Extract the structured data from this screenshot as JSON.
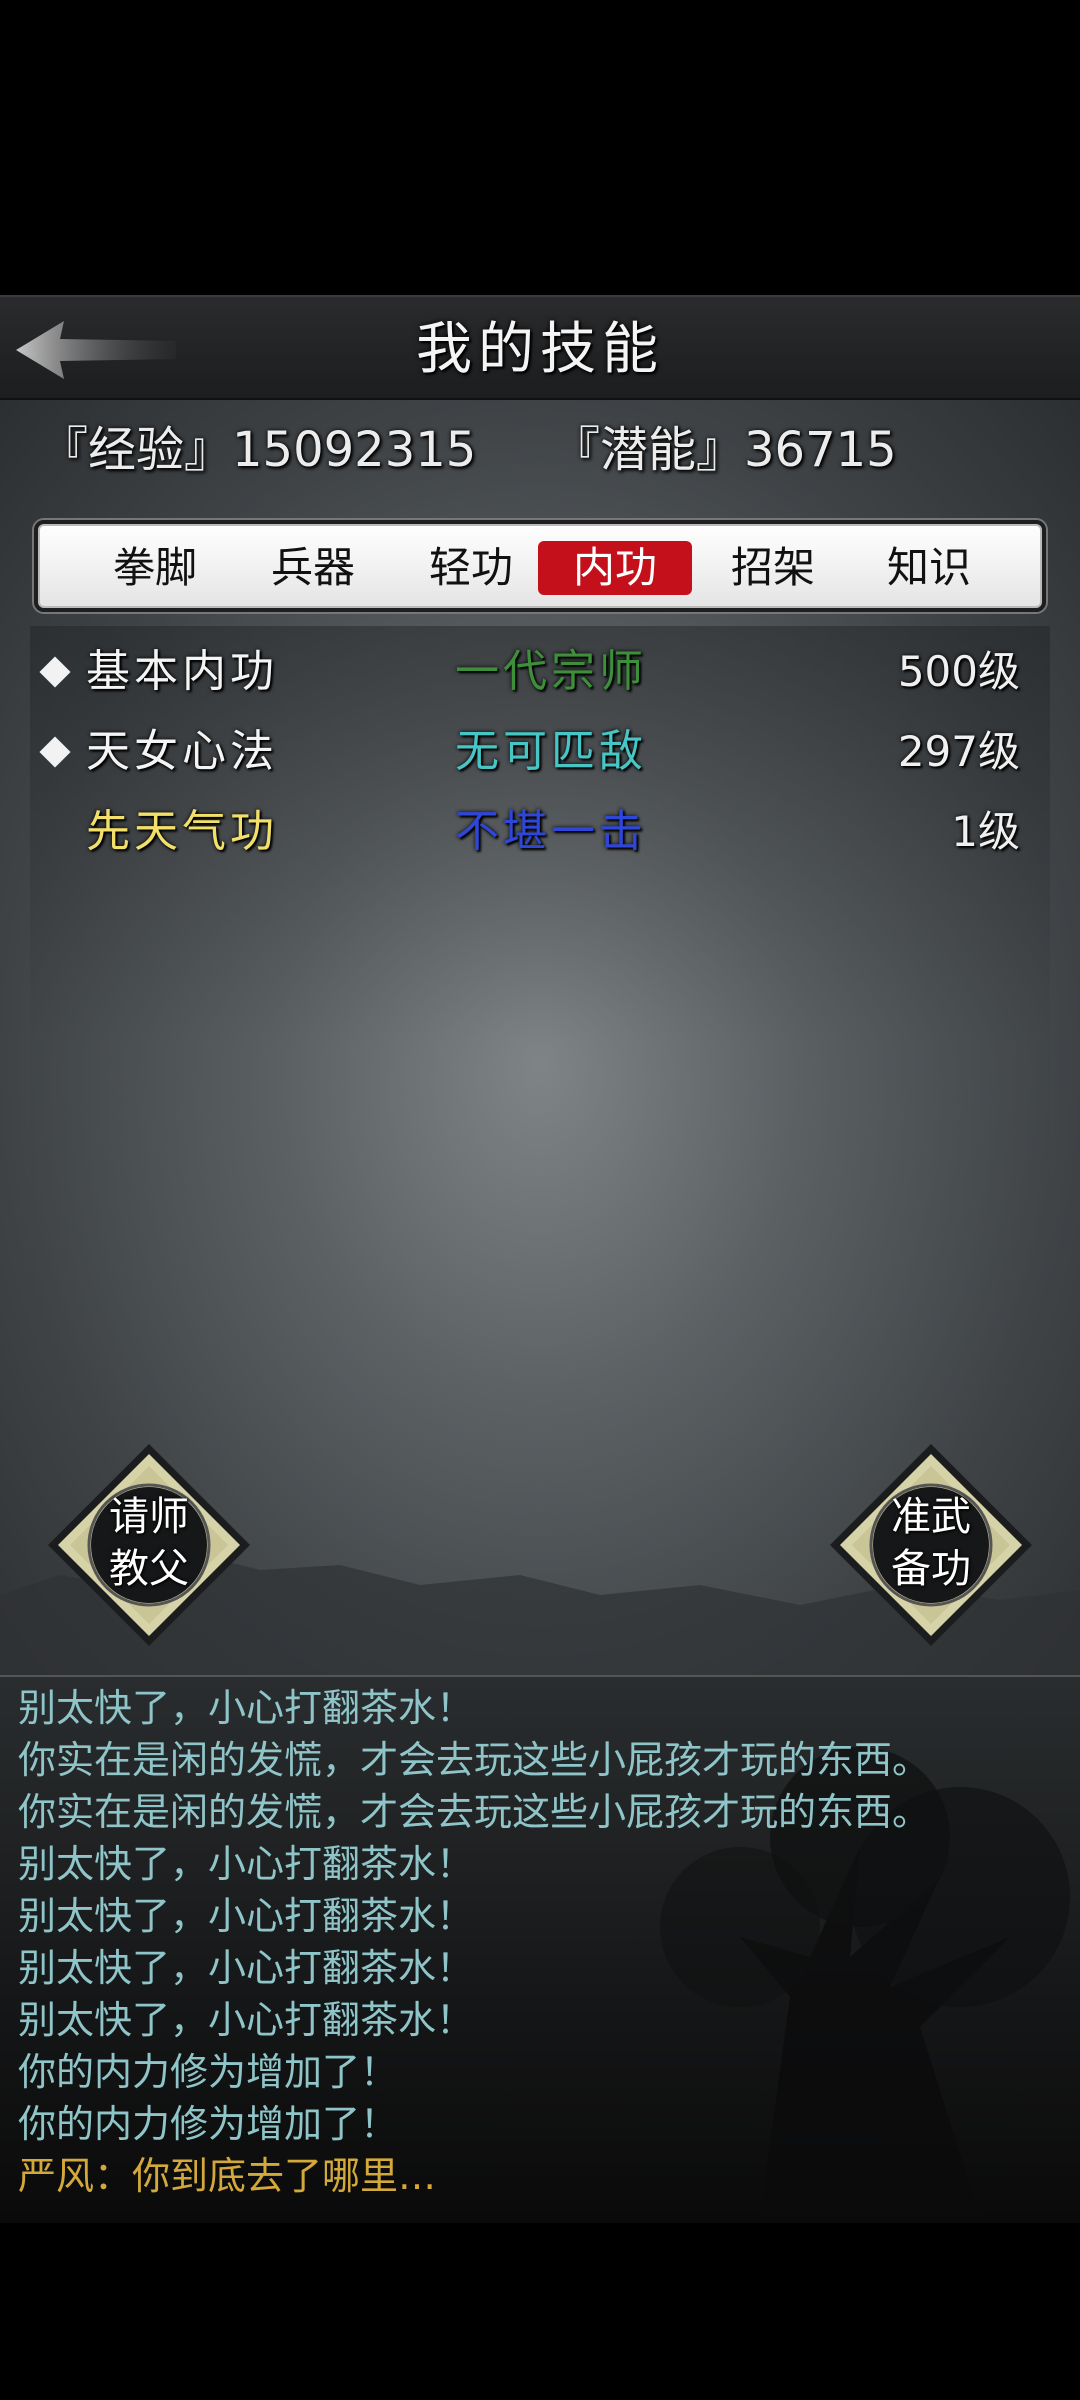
{
  "header": {
    "title": "我的技能"
  },
  "stats": {
    "experience": "『经验』15092315",
    "potential": "『潜能』36715"
  },
  "tabs": [
    {
      "label": "拳脚"
    },
    {
      "label": "兵器"
    },
    {
      "label": "轻功"
    },
    {
      "label": "内功"
    },
    {
      "label": "招架"
    },
    {
      "label": "知识"
    }
  ],
  "active_tab": "内功",
  "skills": [
    {
      "name": "基本内功",
      "rank": "一代宗师",
      "level": "500级",
      "marked": true
    },
    {
      "name": "天女心法",
      "rank": "无可匹敌",
      "level": "297级",
      "marked": true
    },
    {
      "name": "先天气功",
      "rank": "不堪一击",
      "level": "1级",
      "marked": false
    }
  ],
  "buttons": {
    "teacher": {
      "line1": "请师",
      "line2": "教父"
    },
    "prepare": {
      "line1": "准武",
      "line2": "备功"
    }
  },
  "log": [
    "别太快了，小心打翻茶水！",
    "你实在是闲的发慌，才会去玩这些小屁孩才玩的东西。",
    "你实在是闲的发慌，才会去玩这些小屁孩才玩的东西。",
    "别太快了，小心打翻茶水！",
    "别太快了，小心打翻茶水！",
    "别太快了，小心打翻茶水！",
    "别太快了，小心打翻茶水！",
    "你的内力修为增加了！",
    "你的内力修为增加了！",
    "严风：你到底去了哪里…"
  ],
  "colors": {
    "active_tab": "#c4101a",
    "skill_name_white": "#f4f4f4",
    "skill_name_gold": "#f3e06a",
    "rank_grandmaster": "#3d8f3a",
    "rank_invincible": "#47c6c6",
    "rank_weak": "#2f47d8",
    "log_normal": "#8fc5c8",
    "log_npc": "#d4a93b"
  }
}
